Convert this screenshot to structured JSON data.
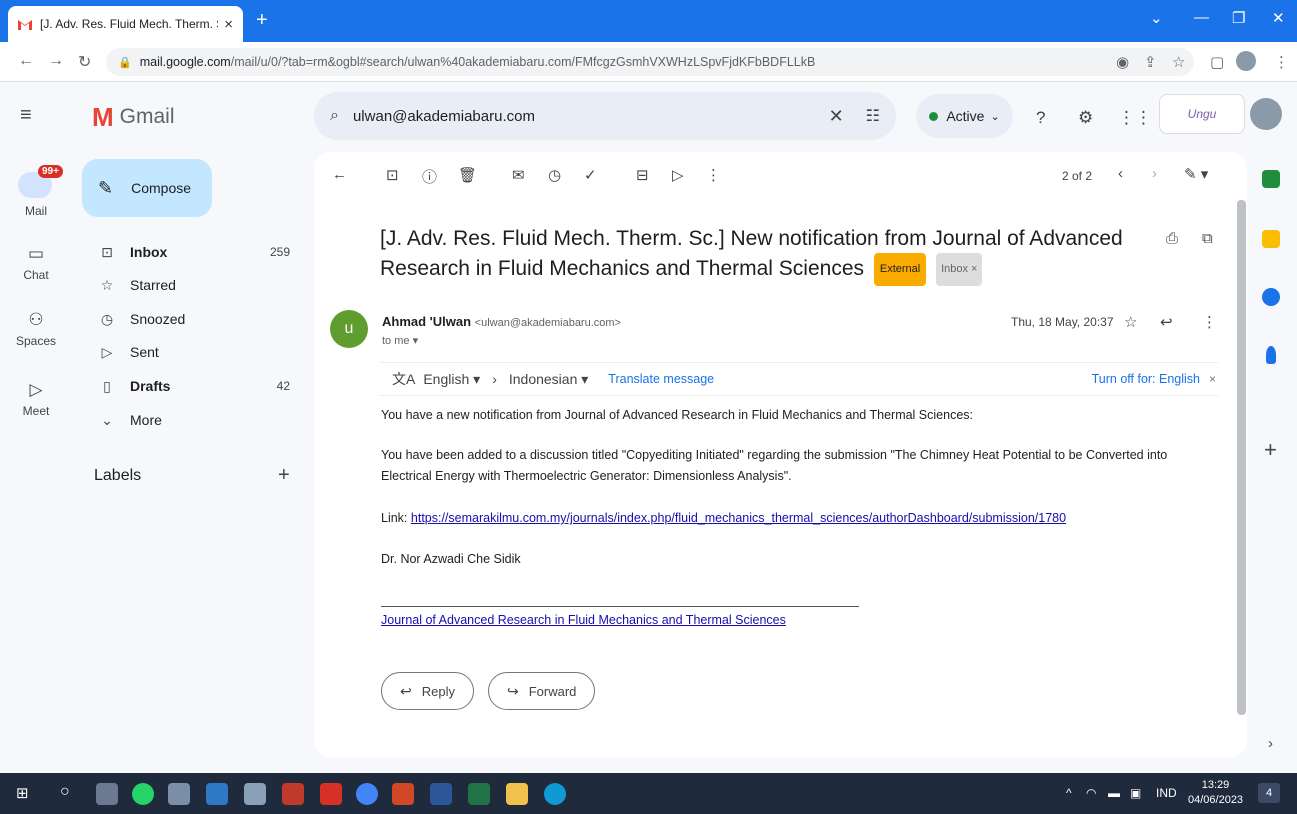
{
  "browser": {
    "tab_title": "[J. Adv. Res. Fluid Mech. Therm. S",
    "url_domain": "mail.google.com",
    "url_path": "/mail/u/0/?tab=rm&ogbl#search/ulwan%40akademiabaru.com/FMfcgzGsmhVXWHzLSpvFjdKFbBDFLLkB"
  },
  "header": {
    "app_name": "Gmail",
    "search_value": "ulwan@akademiabaru.com",
    "status": "Active",
    "brand": "Ungu"
  },
  "rail": {
    "badge": "99+",
    "items": [
      "Mail",
      "Chat",
      "Spaces",
      "Meet"
    ]
  },
  "nav": {
    "compose": "Compose",
    "items": [
      {
        "label": "Inbox",
        "count": "259"
      },
      {
        "label": "Starred",
        "count": ""
      },
      {
        "label": "Snoozed",
        "count": ""
      },
      {
        "label": "Sent",
        "count": ""
      },
      {
        "label": "Drafts",
        "count": "42"
      },
      {
        "label": "More",
        "count": ""
      }
    ],
    "labels_title": "Labels"
  },
  "message": {
    "pager": "2 of 2",
    "subject": "[J. Adv. Res. Fluid Mech. Therm. Sc.] New notification from Journal of Advanced Research in Fluid Mechanics and Thermal Sciences",
    "tag_external": "External",
    "tag_inbox": "Inbox",
    "sender_initial": "u",
    "sender_name": "Ahmad 'Ulwan",
    "sender_email": "<ulwan@akademiabaru.com>",
    "to": "to me",
    "date": "Thu, 18 May, 20:37",
    "translate": {
      "from": "English",
      "to": "Indonesian",
      "action": "Translate message",
      "turn_off": "Turn off for: English"
    },
    "body": {
      "p1": "You have a new notification from Journal of Advanced Research in Fluid Mechanics and Thermal Sciences:",
      "p2": "You have been added to a discussion titled \"Copyediting Initiated\" regarding the submission \"The Chimney Heat Potential to be Converted into Electrical Energy with Thermoelectric Generator: Dimensionless Analysis\".",
      "link_label": "Link:",
      "link": "https://semarakilmu.com.my/journals/index.php/fluid_mechanics_thermal_sciences/authorDashboard/submission/1780",
      "signature": "Dr. Nor Azwadi Che Sidik",
      "journal_link": "Journal of Advanced Research in Fluid Mechanics and Thermal Sciences"
    },
    "reply": "Reply",
    "forward": "Forward"
  },
  "taskbar": {
    "lang": "IND",
    "time": "13:29",
    "date": "04/06/2023",
    "notifications": "4"
  }
}
